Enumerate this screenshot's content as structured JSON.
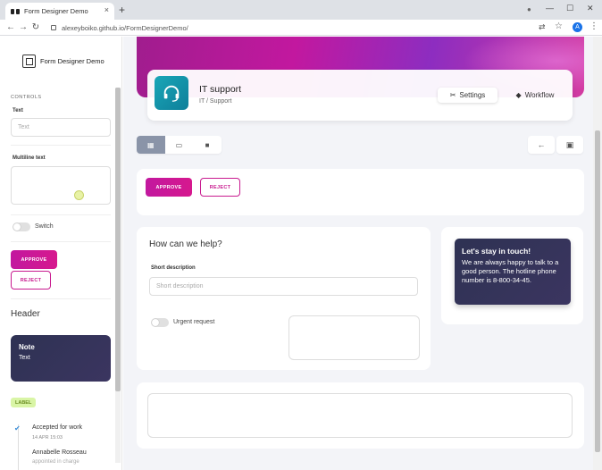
{
  "browser": {
    "tab_title": "Form Designer Demo",
    "tab_close": "×",
    "new_tab": "+",
    "url": "alexeyboiko.github.io/FormDesignerDemo/",
    "avatar_letter": "A",
    "back": "←",
    "forward": "→",
    "reload": "↻",
    "minimize": "—",
    "maximize": "☐",
    "close": "✕",
    "translate": "⇄",
    "star": "☆",
    "menu": "⋮",
    "record": "●"
  },
  "sidebar": {
    "app_title": "Form Designer Demo",
    "section_label": "CONTROLS",
    "text_label": "Text",
    "text_placeholder": "Text",
    "multiline_label": "Multiline text",
    "switch_label": "Switch",
    "approve_label": "APPROVE",
    "reject_label": "REJECT",
    "header_label": "Header",
    "note_title": "Note",
    "note_text": "Text",
    "badge_label": "LABEL",
    "timeline": {
      "title": "Accepted for work",
      "date": "14 APR 15:03",
      "name": "Annabelle Rosseau",
      "sub": "appointed in charge"
    }
  },
  "header": {
    "title": "IT support",
    "breadcrumb": "IT / Support",
    "tabs": [
      {
        "label": "Settings",
        "icon": "tools-icon"
      },
      {
        "label": "Workflow",
        "icon": "cube-icon"
      }
    ]
  },
  "toolbar": {
    "views": [
      "grid-icon",
      "window-icon",
      "square-icon"
    ],
    "back": "←",
    "save": "▣"
  },
  "actions": {
    "approve_label": "APPROVE",
    "reject_label": "REJECT"
  },
  "form": {
    "title": "How can we help?",
    "short_label": "Short description",
    "short_placeholder": "Short description",
    "urgent_label": "Urgent request"
  },
  "contact": {
    "title": "Let's stay in touch!",
    "text": "We are always happy to talk to a good person. The hotline phone number is 8-800-34-45."
  },
  "colors": {
    "accent": "#c81a8f",
    "dark_card": "#2e3253",
    "badge_bg": "#d9f5a6",
    "icon_teal": "#1aa6b7"
  }
}
